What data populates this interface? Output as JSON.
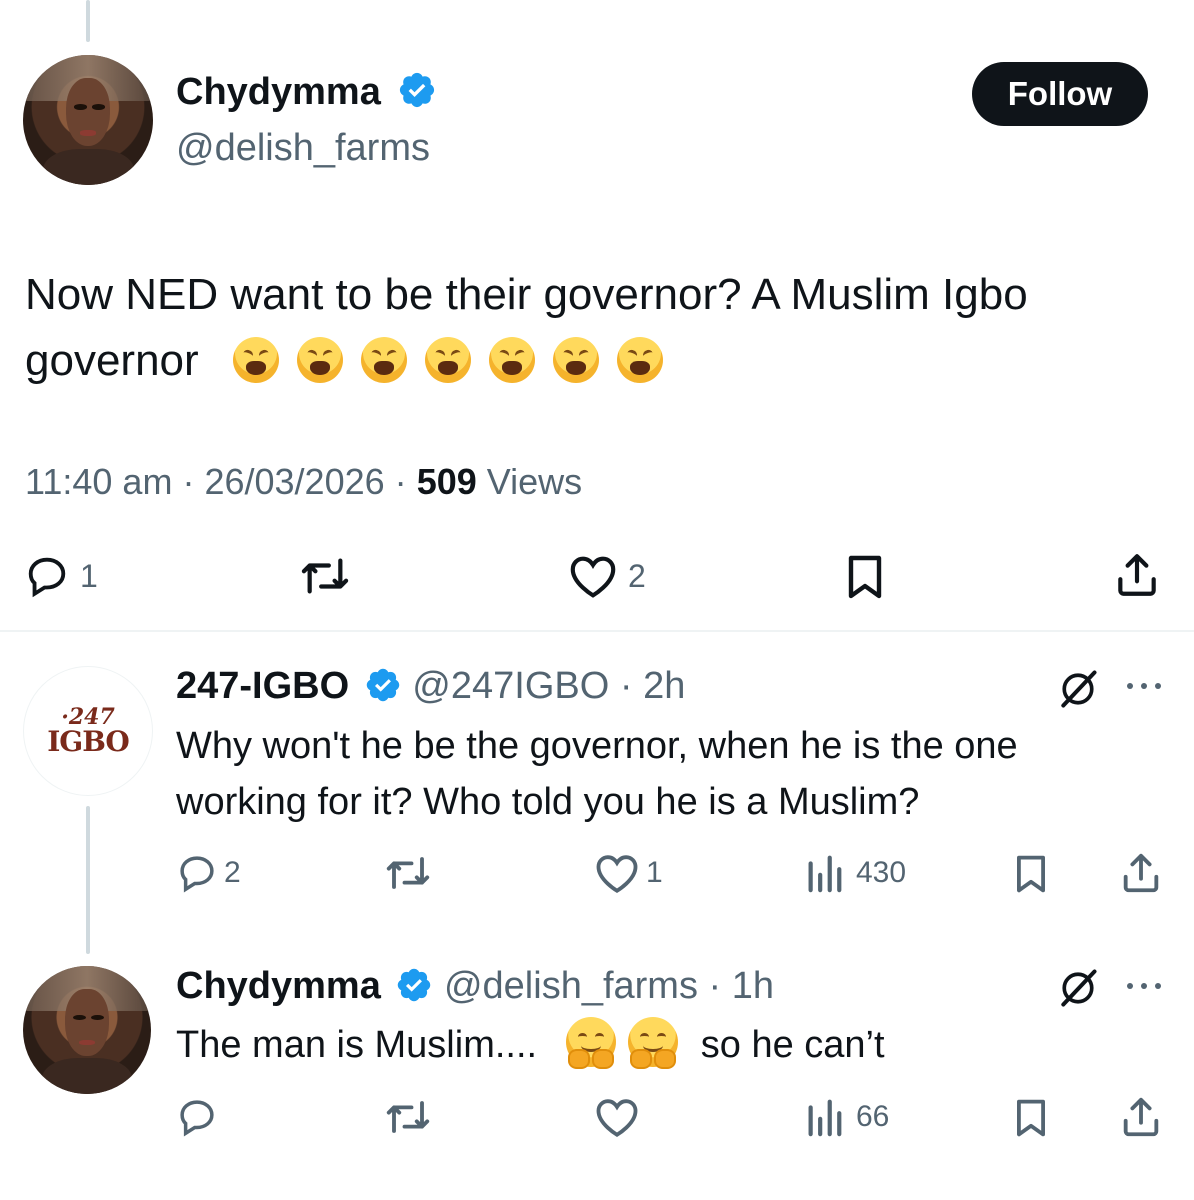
{
  "main_tweet": {
    "author": {
      "name": "Chydymma",
      "handle": "@delish_farms",
      "verified": true
    },
    "follow_label": "Follow",
    "text_line1": "Now NED want to be their governor? A Muslim Igbo",
    "text_line2": "governor",
    "emoji": "weary-face",
    "emoji_count": 7,
    "time": "11:40 am",
    "date": "26/03/2026",
    "views_count": "509",
    "views_label": "Views",
    "replies": "1",
    "likes": "2"
  },
  "replies": [
    {
      "name": "247-IGBO",
      "handle": "@247IGBO",
      "time": "2h",
      "avatar_line1": "247",
      "avatar_line2": "IGBO",
      "text_line1": "Why won't he be the governor, when he is the one",
      "text_line2": "working for it? Who told you he is a Muslim?",
      "replies": "2",
      "likes": "1",
      "views": "430"
    },
    {
      "name": "Chydymma",
      "handle": "@delish_farms",
      "time": "1h",
      "text_before": "The man is Muslim....",
      "emoji": "hugging-face",
      "text_after": "so he can’t",
      "views": "66"
    }
  ],
  "separator": "·",
  "colors": {
    "text": "#0f1419",
    "secondary": "#536471",
    "verified": "#1d9bf0",
    "follow_bg": "#0f1419"
  }
}
